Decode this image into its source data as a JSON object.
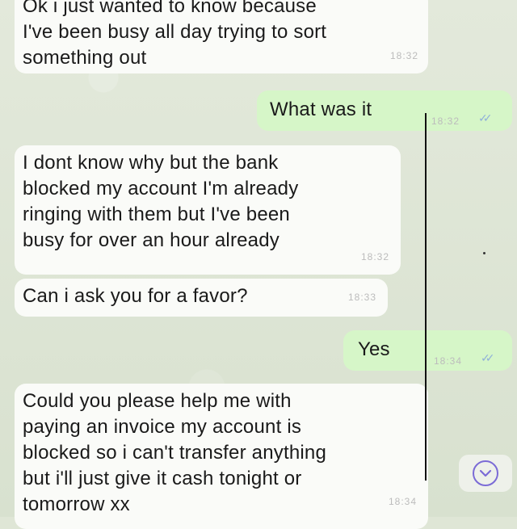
{
  "messages": [
    {
      "text": "Ok i just wanted to know because\nI've been busy all day trying to sort\nsomething out",
      "time": "18:32"
    },
    {
      "text": "What was it",
      "time": "18:32"
    },
    {
      "text": "I dont know why but the bank\nblocked my account I'm already\nringing with them but I've been\nbusy for over an hour already",
      "time": "18:32"
    },
    {
      "text": "Can i ask you for a favor?",
      "time": "18:33"
    },
    {
      "text": "Yes",
      "time": "18:34"
    },
    {
      "text": "Could you please help me with\npaying an invoice my account is\nblocked so i can't transfer anything\nbut i'll just give it cash tonight or\ntomorrow xx",
      "time": "18:34"
    }
  ],
  "icons": {
    "read_receipt": "double-check-icon",
    "scroll_down": "chevron-down-icon"
  },
  "colors": {
    "incoming_bubble": "#fafbf8",
    "outgoing_bubble": "#d6f6c8",
    "read_ticks": "#8fb0d9",
    "scroll_button_accent": "#7b6bd6"
  }
}
